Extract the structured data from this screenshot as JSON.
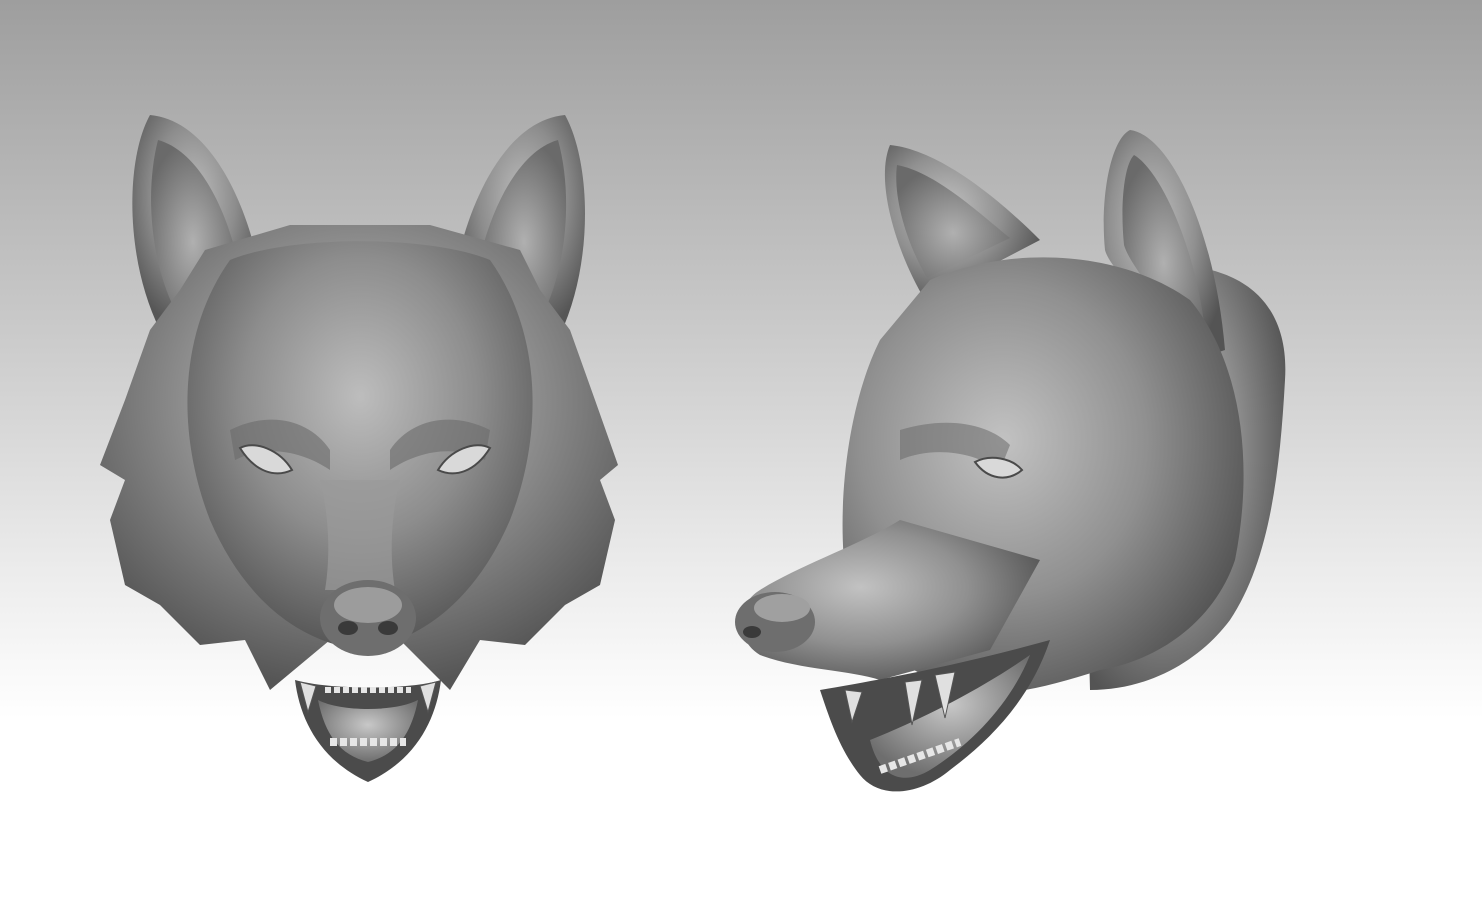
{
  "scene": {
    "background_top": "#9e9e9e",
    "background_bottom": "#ffffff",
    "clay_color": "#8a8a8a",
    "clay_highlight": "#bdbdbd",
    "clay_shadow": "#3f3f3f",
    "models": [
      {
        "view": "front"
      },
      {
        "view": "three-quarter"
      }
    ]
  }
}
